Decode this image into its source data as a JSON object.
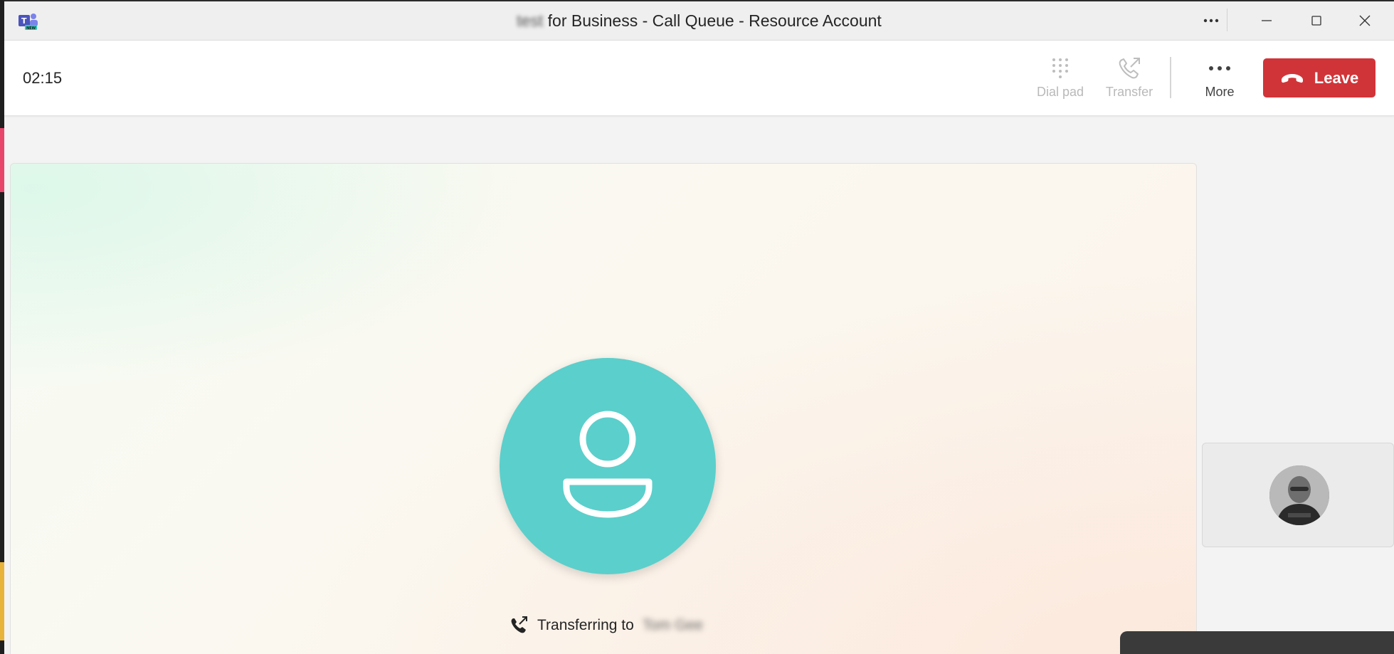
{
  "window": {
    "title_prefix_redacted": "test",
    "title": "for Business - Call Queue - Resource Account",
    "app_icon": "teams-new-icon"
  },
  "callbar": {
    "timer": "02:15",
    "buttons": [
      {
        "label": "Dial pad",
        "icon": "dialpad-icon",
        "enabled": false
      },
      {
        "label": "Transfer",
        "icon": "transfer-icon",
        "enabled": false
      },
      {
        "label": "More",
        "icon": "more-icon",
        "enabled": true
      }
    ],
    "leave": {
      "label": "Leave",
      "icon": "hangup-icon",
      "color": "#d13438"
    }
  },
  "stage": {
    "avatar_color": "#5bcfcb",
    "status_text": "Transferring to",
    "status_target_redacted": "Tom Gee"
  },
  "self_view": {
    "avatar": "user-photo"
  }
}
